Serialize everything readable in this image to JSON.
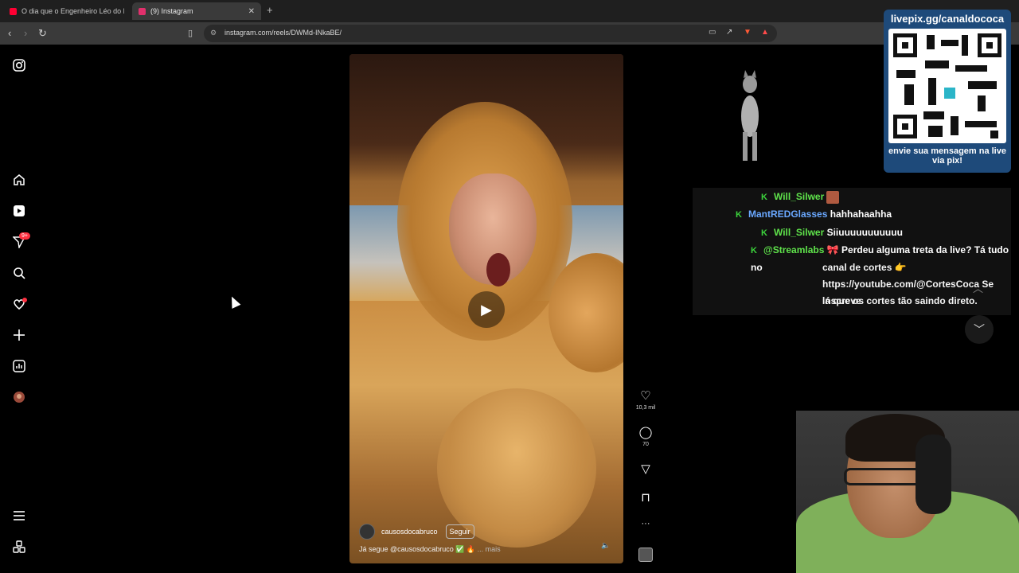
{
  "browser": {
    "tabs": [
      {
        "title": "O dia que o Engenheiro Léo do MBL",
        "favicon_color": "#ff0033"
      },
      {
        "title": "(9) Instagram",
        "favicon_color": "#e1306c",
        "close": "✕"
      }
    ],
    "new_tab": "+",
    "url": "instagram.com/reels/DWMd-INkaBE/"
  },
  "sidebar": {
    "notifications_badge": "9+"
  },
  "reel": {
    "username": "causosdocabruco",
    "follow_label": "Seguir",
    "caption": "Já segue @causosdocabruco ✅ 🔥",
    "more_label": "... mais",
    "likes": "10,3 mil",
    "comments": "70",
    "more_actions": "···"
  },
  "overlay": {
    "qr_title": "livepix.gg/canaldococa",
    "qr_footer": "envie sua mensagem na live via pix!",
    "chat": [
      {
        "user": "Will_Silwer",
        "text": ""
      },
      {
        "user": "MantREDGlasses",
        "text": "hahhahaahha"
      },
      {
        "user": "Will_Silwer",
        "text": "Siiuuuuuuuuuuu"
      },
      {
        "user": "@Streamlabs",
        "text": "🎀 Perdeu alguma treta da live? Tá tudo no"
      },
      {
        "user": "",
        "text": "canal de cortes 👉"
      },
      {
        "user": "",
        "text": "https://youtube.com/@CortesCoca Se inscreve"
      },
      {
        "user": "",
        "text": "lá que os cortes tão saindo direto."
      }
    ]
  },
  "colors": {
    "chat_user_green": "#5fe34b",
    "chat_user_blue": "#6aa8ff",
    "notification_red": "#ff3040",
    "qr_panel": "#1e4a7a"
  }
}
